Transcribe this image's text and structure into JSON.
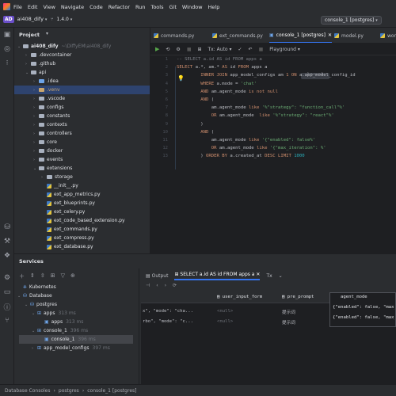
{
  "menu": [
    "File",
    "Edit",
    "View",
    "Navigate",
    "Code",
    "Refactor",
    "Run",
    "Tools",
    "Git",
    "Window",
    "Help"
  ],
  "project": {
    "badge": "AD",
    "name": "ai408_dify",
    "version": "1.4.0",
    "run_config": "console_1 [postgres]"
  },
  "panel": {
    "title": "Project"
  },
  "tree": [
    {
      "label": "ai408_dify",
      "hint": "~\\DiffyEM\\ai408_dify",
      "depth": 0,
      "kind": "root"
    },
    {
      "label": ".devcontainer",
      "depth": 1,
      "kind": "folder"
    },
    {
      "label": ".github",
      "depth": 1,
      "kind": "folder"
    },
    {
      "label": "api",
      "depth": 1,
      "kind": "folder-open"
    },
    {
      "label": ".idea",
      "depth": 2,
      "kind": "folder-blue"
    },
    {
      "label": ".venv",
      "depth": 2,
      "kind": "folder-orange"
    },
    {
      "label": ".vscode",
      "depth": 2,
      "kind": "folder"
    },
    {
      "label": "configs",
      "depth": 2,
      "kind": "folder"
    },
    {
      "label": "constants",
      "depth": 2,
      "kind": "folder"
    },
    {
      "label": "contexts",
      "depth": 2,
      "kind": "folder"
    },
    {
      "label": "controllers",
      "depth": 2,
      "kind": "folder"
    },
    {
      "label": "core",
      "depth": 2,
      "kind": "folder"
    },
    {
      "label": "docker",
      "depth": 2,
      "kind": "folder"
    },
    {
      "label": "events",
      "depth": 2,
      "kind": "folder"
    },
    {
      "label": "extensions",
      "depth": 2,
      "kind": "folder-open"
    },
    {
      "label": "storage",
      "depth": 3,
      "kind": "folder"
    },
    {
      "label": "__init__.py",
      "depth": 3,
      "kind": "py"
    },
    {
      "label": "ext_app_metrics.py",
      "depth": 3,
      "kind": "py"
    },
    {
      "label": "ext_blueprints.py",
      "depth": 3,
      "kind": "py"
    },
    {
      "label": "ext_celery.py",
      "depth": 3,
      "kind": "py"
    },
    {
      "label": "ext_code_based_extension.py",
      "depth": 3,
      "kind": "py"
    },
    {
      "label": "ext_commands.py",
      "depth": 3,
      "kind": "py"
    },
    {
      "label": "ext_compress.py",
      "depth": 3,
      "kind": "py"
    },
    {
      "label": "ext_database.py",
      "depth": 3,
      "kind": "py"
    }
  ],
  "tabs": [
    "commands.py",
    "ext_commands.py",
    "console_1 [postgres]",
    "model.py",
    "work"
  ],
  "editor_toolbar": {
    "tx": "Tx: Auto",
    "playground": "Playground"
  },
  "code_lines": [
    [
      {
        "t": "-- SELECT a.id AS id FROM apps a",
        "c": "cmt"
      }
    ],
    [
      {
        "t": "SELECT ",
        "c": "kw"
      },
      {
        "t": "a.*, am.* ",
        "c": ""
      },
      {
        "t": "AS ",
        "c": "kw"
      },
      {
        "t": "id ",
        "c": ""
      },
      {
        "t": "FROM ",
        "c": "kw"
      },
      {
        "t": "apps a",
        "c": ""
      }
    ],
    [
      {
        "t": "         INNER JOIN ",
        "c": "kw"
      },
      {
        "t": "app_model_configs am ",
        "c": ""
      },
      {
        "t": "1 ON ",
        "c": "kw"
      },
      {
        "t": "a.app_model_config_id",
        "c": ""
      }
    ],
    [
      {
        "t": "         WHERE ",
        "c": "kw"
      },
      {
        "t": "a.mode = ",
        "c": ""
      },
      {
        "t": "'chat'",
        "c": "str"
      }
    ],
    [
      {
        "t": "         AND ",
        "c": "kw"
      },
      {
        "t": "am.agent_mode ",
        "c": ""
      },
      {
        "t": "is not null",
        "c": "kw"
      }
    ],
    [
      {
        "t": "         AND ",
        "c": "kw"
      },
      {
        "t": "(",
        "c": ""
      }
    ],
    [
      {
        "t": "             am.agent_mode ",
        "c": ""
      },
      {
        "t": "like ",
        "c": "kw"
      },
      {
        "t": "'%\"strategy\": \"function_call\"%'",
        "c": "str"
      }
    ],
    [
      {
        "t": "             OR ",
        "c": "kw"
      },
      {
        "t": "am.agent_mode  ",
        "c": ""
      },
      {
        "t": "like ",
        "c": "kw"
      },
      {
        "t": "'%\"strategy\": \"react\"%'",
        "c": "str"
      }
    ],
    [
      {
        "t": "         )",
        "c": ""
      }
    ],
    [
      {
        "t": "         AND ",
        "c": "kw"
      },
      {
        "t": "(",
        "c": ""
      }
    ],
    [
      {
        "t": "             am.agent_mode ",
        "c": ""
      },
      {
        "t": "like ",
        "c": "kw"
      },
      {
        "t": "'{\"enabled\": false%'",
        "c": "str"
      }
    ],
    [
      {
        "t": "             OR ",
        "c": "kw"
      },
      {
        "t": "am.agent_mode ",
        "c": ""
      },
      {
        "t": "like ",
        "c": "kw"
      },
      {
        "t": "'{\"max_iteration\": %'",
        "c": "str"
      }
    ],
    [
      {
        "t": "         ) ",
        "c": ""
      },
      {
        "t": "ORDER BY ",
        "c": "kw"
      },
      {
        "t": "a.created_at ",
        "c": ""
      },
      {
        "t": "DESC LIMIT ",
        "c": "kw"
      },
      {
        "t": "1000",
        "c": "num"
      }
    ]
  ],
  "services": {
    "title": "Services",
    "tree": [
      {
        "label": "Kubernetes",
        "depth": 0,
        "extra": ""
      },
      {
        "label": "Database",
        "depth": 0,
        "extra": ""
      },
      {
        "label": "postgres",
        "depth": 1,
        "extra": ""
      },
      {
        "label": "apps",
        "depth": 2,
        "extra": "313 ms"
      },
      {
        "label": "apps",
        "depth": 3,
        "extra": "313 ms"
      },
      {
        "label": "console_1",
        "depth": 2,
        "extra": "396 ms"
      },
      {
        "label": "console_1",
        "depth": 3,
        "extra": "396 ms"
      },
      {
        "label": "app_model_configs",
        "depth": 2,
        "extra": "397 ms"
      }
    ],
    "output_tab": "Output",
    "result_tab": "SELECT a.id AS id FROM apps a",
    "columns": [
      "user_input_form",
      "pre_prompt",
      "agent_mode"
    ],
    "rows": [
      [
        "x\", \"mode\": \"cha...",
        "<null>",
        "提示词",
        "{\"enabled\": false, \"max_ite"
      ],
      [
        "rbo\", \"mode\": \"c...",
        "<null>",
        "提示词",
        "{\"enabled\": false, \"max_ite"
      ]
    ]
  },
  "status": [
    "Database Consoles",
    "postgres",
    "console_1 [postgres]"
  ]
}
